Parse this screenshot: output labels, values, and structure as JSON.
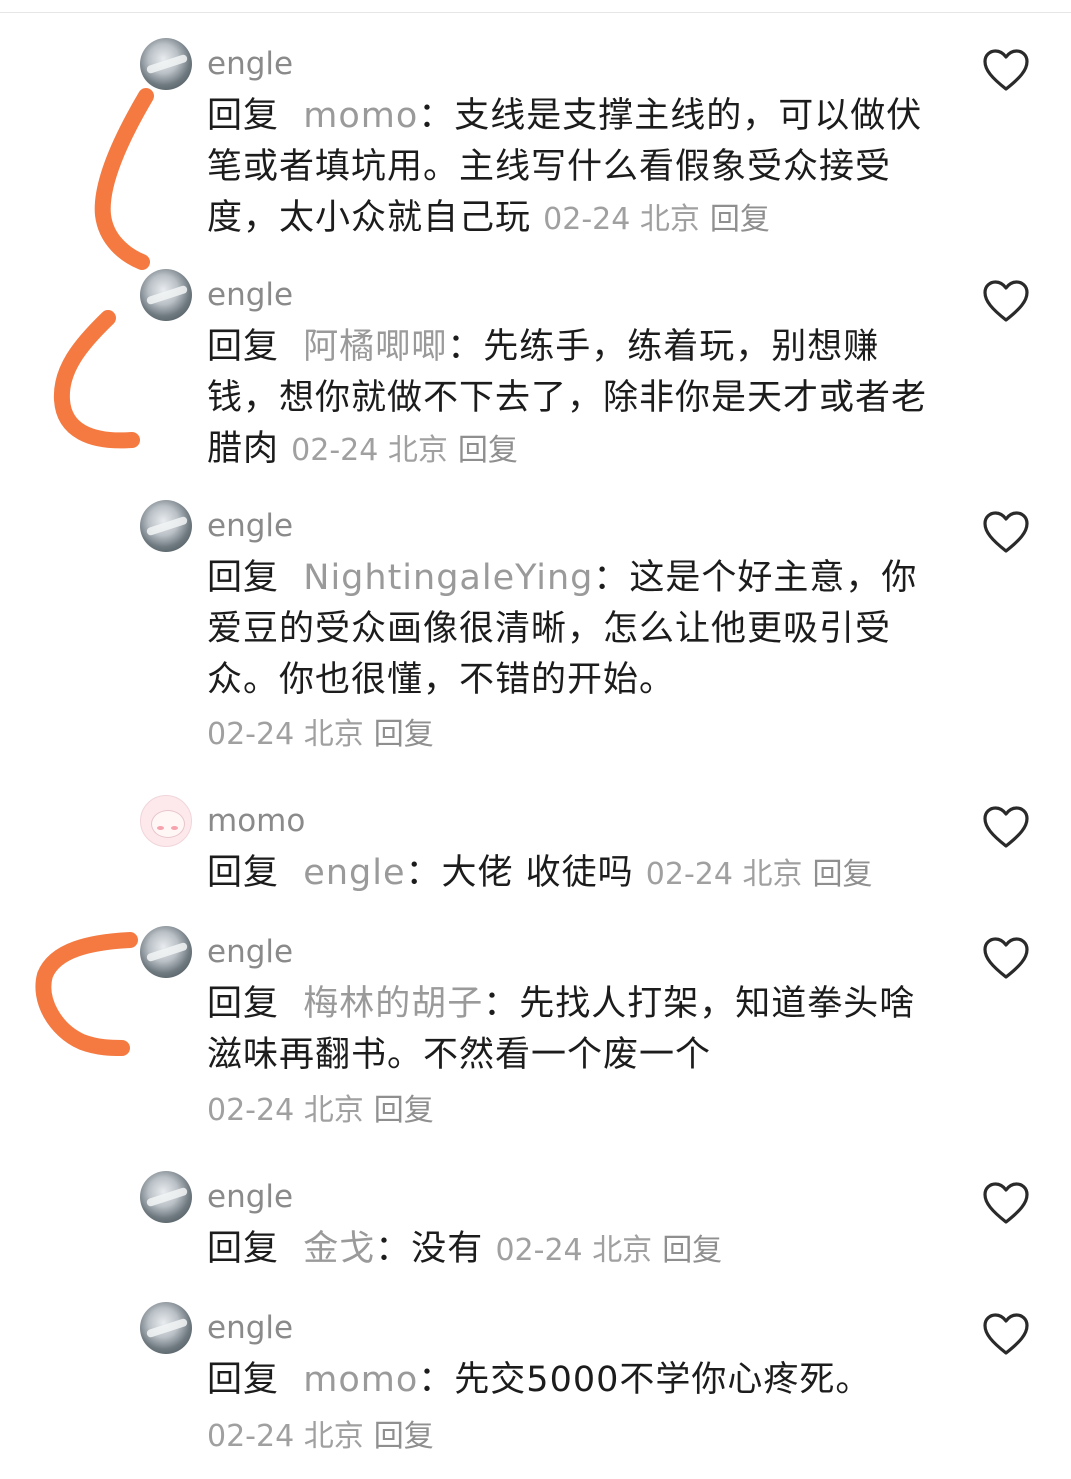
{
  "reply_prefix": "回复",
  "reply_action": "回复",
  "annotation_color": "#f47a42",
  "comments": [
    {
      "user": "engle",
      "avatar": "mountain-avatar",
      "reply_to": "momo",
      "text": "：支线是支撑主线的，可以做伏笔或者填坑用。主线写什么看假象受众接受度，太小众就自己玩",
      "date": "02-24",
      "location": "北京"
    },
    {
      "user": "engle",
      "avatar": "mountain-avatar",
      "reply_to": "阿橘唧唧",
      "text": "：先练手，练着玩，别想赚钱，想你就做不下去了，除非你是天才或者老腊肉",
      "date": "02-24",
      "location": "北京"
    },
    {
      "user": "engle",
      "avatar": "mountain-avatar",
      "reply_to": "NightingaleYing",
      "text": "：这是个好主意，你爱豆的受众画像很清晰，怎么让他更吸引受众。你也很懂，不错的开始。",
      "date": "02-24",
      "location": "北京"
    },
    {
      "user": "momo",
      "avatar": "cartoon-avatar",
      "reply_to": "engle",
      "text": "：大佬 收徒吗",
      "date": "02-24",
      "location": "北京"
    },
    {
      "user": "engle",
      "avatar": "mountain-avatar",
      "reply_to": "梅林的胡子",
      "text": "：先找人打架，知道拳头啥滋味再翻书。不然看一个废一个",
      "date": "02-24",
      "location": "北京"
    },
    {
      "user": "engle",
      "avatar": "mountain-avatar",
      "reply_to": "金戈",
      "text": "：没有",
      "date": "02-24",
      "location": "北京"
    },
    {
      "user": "engle",
      "avatar": "mountain-avatar",
      "reply_to": "momo",
      "text": "：先交5000不学你心疼死。",
      "date": "02-24",
      "location": "北京"
    }
  ]
}
